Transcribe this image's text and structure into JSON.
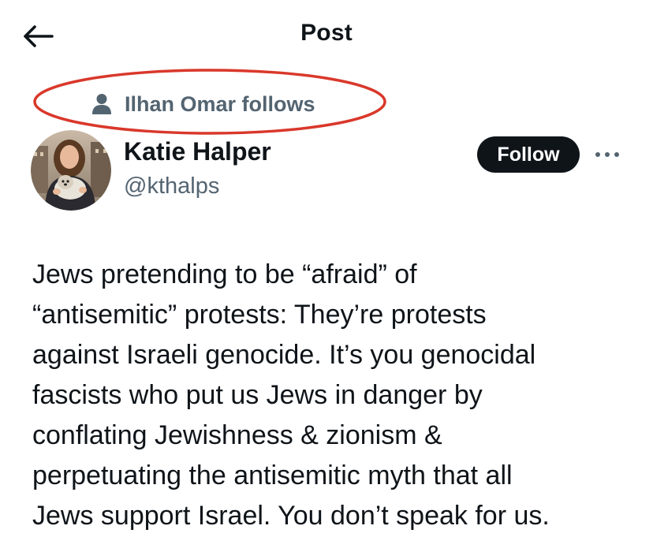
{
  "header": {
    "title": "Post",
    "back_icon": "arrow-left-icon"
  },
  "social_context": {
    "icon": "person-icon",
    "text": "Ilhan Omar follows",
    "highlight_color": "#d9382b"
  },
  "author": {
    "name": "Katie Halper",
    "handle": "@kthalps",
    "avatar": "avatar-photo"
  },
  "actions": {
    "follow_label": "Follow",
    "more_icon": "more-horizontal-icon"
  },
  "tweet": {
    "lines": [
      "Jews pretending to be “afraid” of",
      "“antisemitic” protests: They’re protests",
      "against Israeli genocide. It’s you genocidal",
      "fascists who put us Jews in danger by",
      "conflating Jewishness & zionism &",
      "perpetuating the antisemitic myth that all",
      "Jews support Israel. You don’t speak for us."
    ]
  },
  "colors": {
    "text_primary": "#0f1419",
    "text_secondary": "#536471",
    "follow_bg": "#0f1419",
    "follow_text": "#ffffff",
    "annotation_red": "#d9382b"
  }
}
